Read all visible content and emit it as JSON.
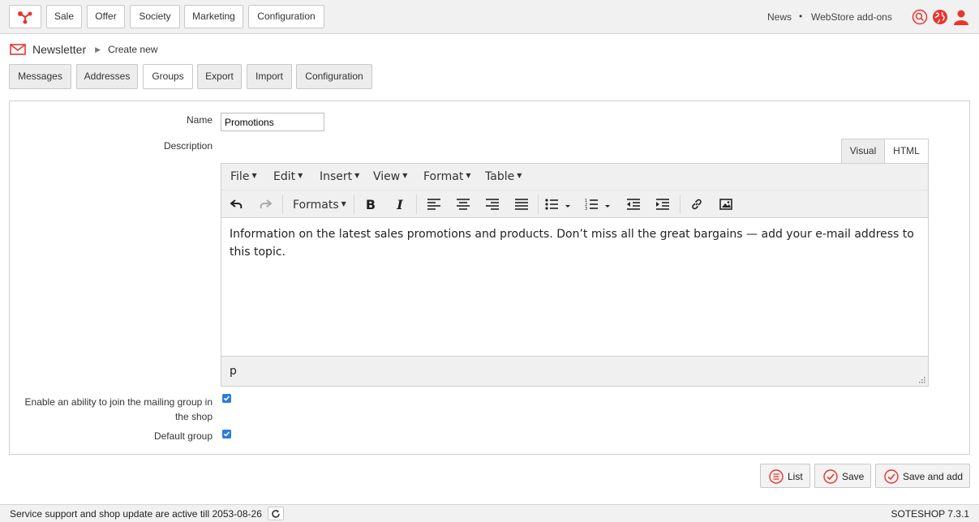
{
  "topbar": {
    "nav": [
      "Sale",
      "Offer",
      "Society",
      "Marketing",
      "Configuration"
    ],
    "links": [
      "News",
      "•",
      "WebStore add-ons"
    ],
    "icons": [
      "search-icon",
      "globe-icon",
      "user-icon"
    ],
    "brand_color": "#e8352e"
  },
  "breadcrumb": {
    "section": "Newsletter",
    "current": "Create new"
  },
  "tabs": [
    "Messages",
    "Addresses",
    "Groups",
    "Export",
    "Import",
    "Configuration"
  ],
  "active_tab": "Groups",
  "form": {
    "name_label": "Name",
    "name_value": "Promotions",
    "description_label": "Description",
    "editor_modes": [
      "Visual",
      "HTML"
    ],
    "active_mode": "HTML",
    "menu": [
      "File",
      "Edit",
      "Insert",
      "View",
      "Format",
      "Table"
    ],
    "formats_label": "Formats",
    "content": "Information on the latest sales promotions and products. Don’t miss all the great bargains — add your e-mail address to this topic.",
    "path": "p",
    "join_label": "Enable an ability to join the mailing group in the shop",
    "join_checked": true,
    "default_label": "Default group",
    "default_checked": true
  },
  "actions": {
    "list": "List",
    "save": "Save",
    "save_add": "Save and add"
  },
  "footer": {
    "support": "Service support and shop update are active till 2053-08-26",
    "version": "SOTESHOP 7.3.1"
  }
}
